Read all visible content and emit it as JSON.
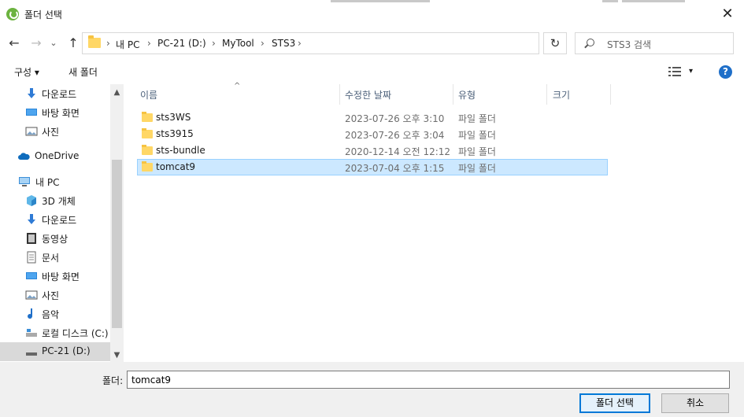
{
  "titlebar": {
    "title": "폴더 선택",
    "close": "✕"
  },
  "nav": {
    "back": "←",
    "forward": "→",
    "recent": "⌄",
    "up": "↑",
    "breadcrumb": [
      "내 PC",
      "PC-21 (D:)",
      "MyTool",
      "STS3"
    ],
    "sep": "›",
    "refresh": "↻",
    "search_placeholder": "STS3 검색"
  },
  "toolbar": {
    "organize": "구성 ▾",
    "new_folder": "새 폴더",
    "view_dd": "▾",
    "help": "?"
  },
  "sidebar": {
    "items": [
      {
        "label": "다운로드",
        "icon": "download-icon"
      },
      {
        "label": "바탕 화면",
        "icon": "desktop-icon"
      },
      {
        "label": "사진",
        "icon": "pictures-icon"
      },
      {
        "label": "OneDrive",
        "icon": "cloud-icon"
      },
      {
        "label": "내 PC",
        "icon": "computer-icon"
      },
      {
        "label": "3D 개체",
        "icon": "3d-objects-icon"
      },
      {
        "label": "다운로드",
        "icon": "download-icon"
      },
      {
        "label": "동영상",
        "icon": "video-icon"
      },
      {
        "label": "문서",
        "icon": "document-icon"
      },
      {
        "label": "바탕 화면",
        "icon": "desktop-icon"
      },
      {
        "label": "사진",
        "icon": "pictures-icon"
      },
      {
        "label": "음악",
        "icon": "music-icon"
      },
      {
        "label": "로컬 디스크 (C:)",
        "icon": "drive-icon"
      },
      {
        "label": "PC-21 (D:)",
        "icon": "drive-icon"
      }
    ],
    "scroll_up": "▲",
    "scroll_down": "▼"
  },
  "columns": {
    "name": "이름",
    "modified": "수정한 날짜",
    "type": "유형",
    "size": "크기",
    "sort_caret": "^"
  },
  "files": [
    {
      "name": "sts3WS",
      "modified": "2023-07-26 오후 3:10",
      "type": "파일 폴더"
    },
    {
      "name": "sts3915",
      "modified": "2023-07-26 오후 3:04",
      "type": "파일 폴더"
    },
    {
      "name": "sts-bundle",
      "modified": "2020-12-14 오전 12:12",
      "type": "파일 폴더"
    },
    {
      "name": "tomcat9",
      "modified": "2023-07-04 오후 1:15",
      "type": "파일 폴더"
    }
  ],
  "selected_file_index": 3,
  "footer": {
    "folder_label": "폴더:",
    "folder_value": "tomcat9",
    "select_button": "폴더 선택",
    "cancel_button": "취소"
  }
}
